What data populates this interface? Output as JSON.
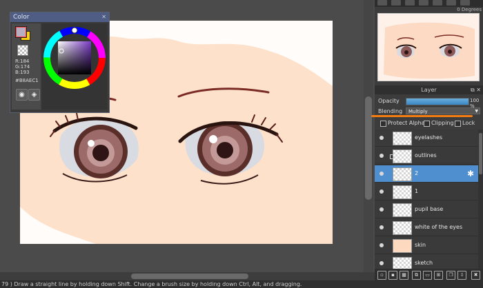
{
  "color_window": {
    "title": "Color",
    "close": "✕",
    "main_color": "#b8aec1",
    "r": "R:184",
    "g": "G:174",
    "b": "B:193",
    "hex": "#B8AEC1"
  },
  "navigator": {
    "rotation": "0 Degrees"
  },
  "layer_panel": {
    "title": "Layer",
    "opacity_label": "Opacity",
    "opacity_value": "100 %",
    "opacity_percent": 100,
    "blending_label": "Blending",
    "blending_value": "Multiply",
    "protect_alpha": "Protect Alpha",
    "clipping": "Clipping",
    "lock": "Lock",
    "layers": [
      {
        "name": "eyelashes",
        "selected": false
      },
      {
        "name": "outlines",
        "selected": false
      },
      {
        "name": "2",
        "selected": true
      },
      {
        "name": "1",
        "selected": false
      },
      {
        "name": "pupil base",
        "selected": false
      },
      {
        "name": "white of the eyes",
        "selected": false
      },
      {
        "name": "skin",
        "selected": false
      },
      {
        "name": "sketch",
        "selected": false
      }
    ]
  },
  "status_bar": {
    "text": "79 )   Draw a straight line by holding down Shift. Change a brush size by holding down Ctrl, Alt, and dragging."
  },
  "colors": {
    "accent": "#4f8fcf",
    "highlight": "#f57c10",
    "skin": "#fde1cb"
  }
}
